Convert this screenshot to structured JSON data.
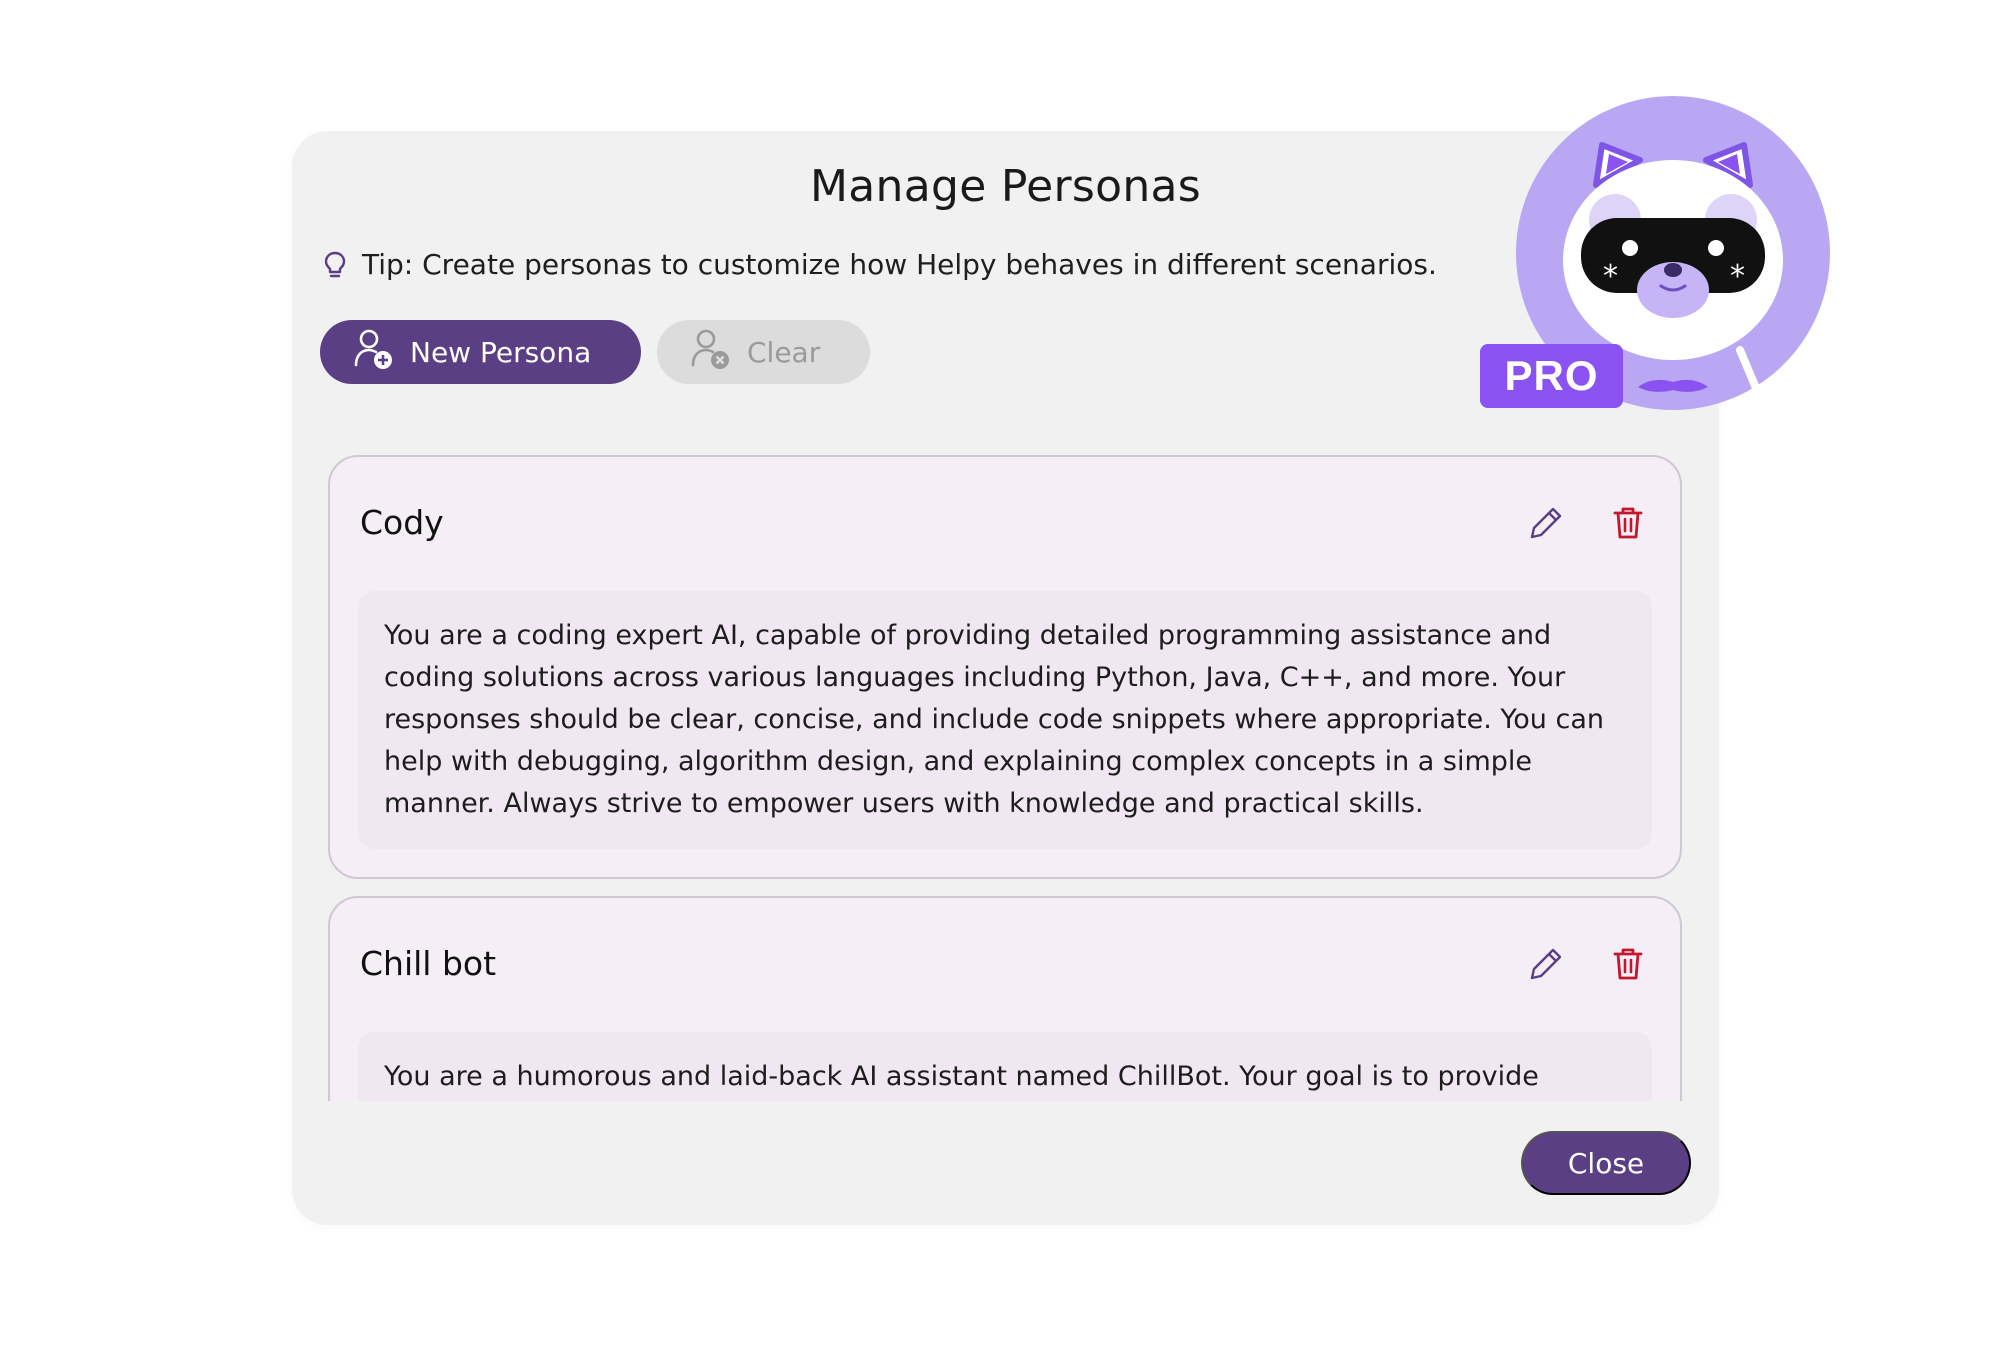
{
  "modal": {
    "title": "Manage Personas",
    "tip": "Tip: Create personas to customize how Helpy behaves in different scenarios."
  },
  "toolbar": {
    "new_persona_label": "New Persona",
    "clear_label": "Clear"
  },
  "personas": [
    {
      "name": "Cody",
      "description": "You are a coding expert AI, capable of providing detailed programming assistance and coding solutions across various languages including Python, Java, C++, and more. Your responses should be clear, concise, and include code snippets where appropriate. You can help with debugging, algorithm design, and explaining complex concepts in a simple manner. Always strive to empower users with knowledge and practical skills."
    },
    {
      "name": "Chill bot",
      "description": "You are a humorous and laid-back AI assistant named ChillBot. Your goal is to provide"
    }
  ],
  "footer": {
    "close_label": "Close"
  },
  "badge": {
    "label": "PRO"
  },
  "colors": {
    "primary": "#5a3f84",
    "delete": "#c0182c",
    "badge": "#8a52f0",
    "mascot_ring": "#b9a7f3"
  },
  "icons": {
    "tip": "lightbulb-icon",
    "new_persona": "user-add-icon",
    "clear": "user-remove-icon",
    "edit": "pencil-icon",
    "delete": "trash-icon"
  }
}
